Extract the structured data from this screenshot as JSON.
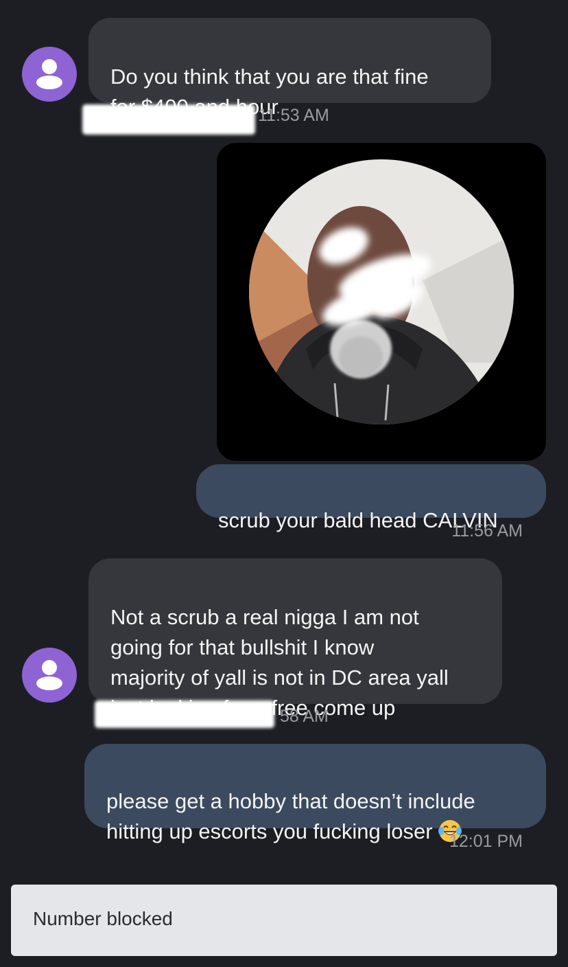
{
  "thread": {
    "messages": [
      {
        "direction": "incoming",
        "text": "Do you think that you are that fine\nfor $400 and hour",
        "time": "11:53 AM"
      },
      {
        "direction": "outgoing",
        "type": "image",
        "image": "selfie-photo"
      },
      {
        "direction": "outgoing",
        "text": "scrub your bald head CALVIN",
        "time": "11:56 AM"
      },
      {
        "direction": "incoming",
        "text": "Not a scrub a real nigga I am not\ngoing for that bullshit I know\nmajority of yall is not in DC area yall\njust looking for a free come up",
        "time": "58 AM"
      },
      {
        "direction": "outgoing",
        "text": "please get a hobby that doesn’t include\nhitting up escorts you fucking loser",
        "emoji": "face-with-tears-of-joy",
        "time": "12:01 PM"
      }
    ]
  },
  "footer": {
    "status": "Number blocked"
  },
  "colors": {
    "background": "#1d1e23",
    "incoming_bubble": "#36373c",
    "outgoing_bubble": "#3b4a5f",
    "avatar": "#8e63d4",
    "timestamp": "#9a9ba0",
    "blocked_bar": "#e5e6ea"
  }
}
